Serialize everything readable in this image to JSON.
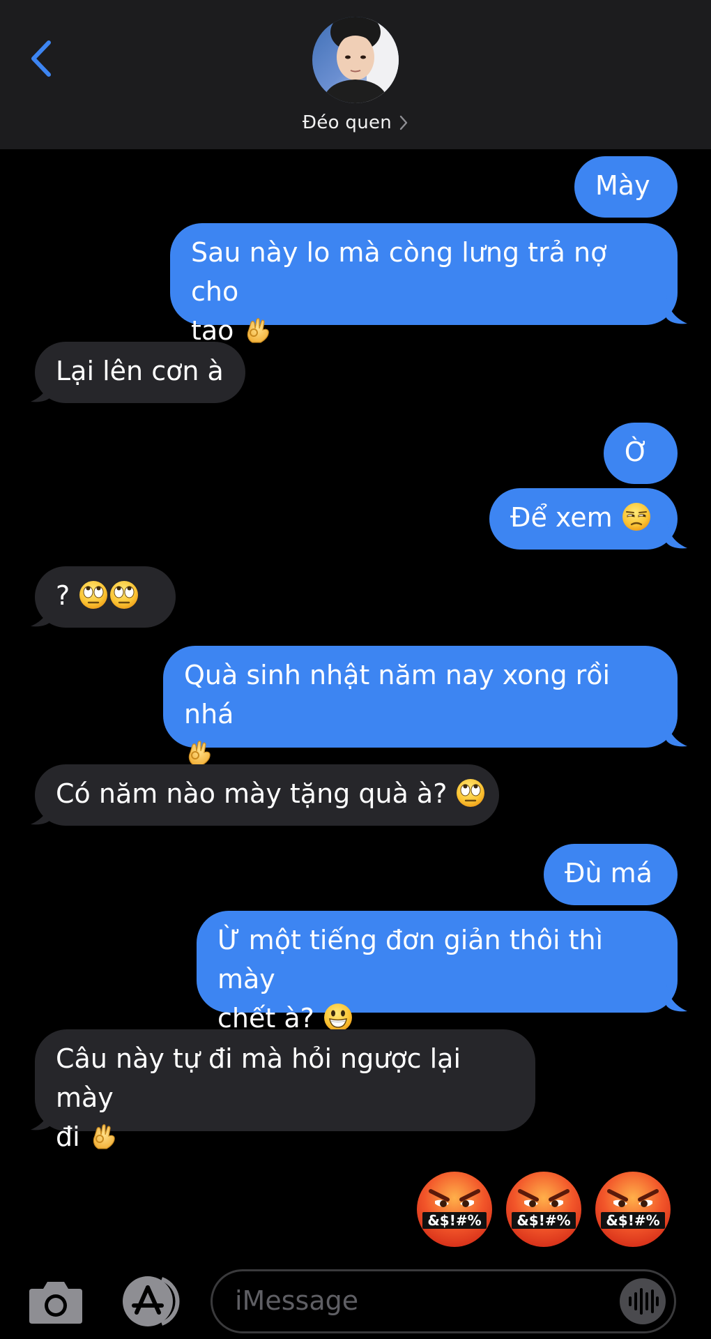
{
  "header": {
    "contact_name": "Đéo quen",
    "back_icon": "chevron-left-icon",
    "accent_color": "#3d85f2"
  },
  "messages": [
    {
      "direction": "out",
      "text": "Mày"
    },
    {
      "direction": "out",
      "text": "Sau này lo mà còng lưng trả nợ cho",
      "text2": "tao",
      "emoji": "ok-hand"
    },
    {
      "direction": "in",
      "text": "Lại lên cơn à"
    },
    {
      "direction": "out",
      "text": "Ờ"
    },
    {
      "direction": "out",
      "text": "Để xem",
      "emoji": "unamused"
    },
    {
      "direction": "in",
      "text": "?",
      "emoji": "eye-roll eye-roll"
    },
    {
      "direction": "out",
      "text": "Quà sinh nhật năm nay xong rồi nhá",
      "emoji": "ok-hand"
    },
    {
      "direction": "in",
      "text": "Có năm nào mày tặng quà à?",
      "emoji": "eye-roll"
    },
    {
      "direction": "out",
      "text": "Đù má"
    },
    {
      "direction": "out",
      "text": "Ừ một tiếng đơn giản thôi thì mày",
      "text2": "chết à?",
      "emoji": "grinning"
    },
    {
      "direction": "in",
      "text": "Câu này tự đi mà hỏi ngược lại mày",
      "text2": "đi",
      "emoji": "ok-hand"
    }
  ],
  "big_emojis": {
    "label": "&$!#%",
    "count": 3,
    "icon": "face-with-symbols-icon"
  },
  "composer": {
    "placeholder": "iMessage",
    "camera_icon": "camera-icon",
    "appstore_icon": "app-store-icon",
    "audio_icon": "audio-waveform-icon"
  },
  "colors": {
    "outgoing_bubble": "#3d85f2",
    "incoming_bubble": "#26262a",
    "header_bg": "#1c1c1e"
  }
}
